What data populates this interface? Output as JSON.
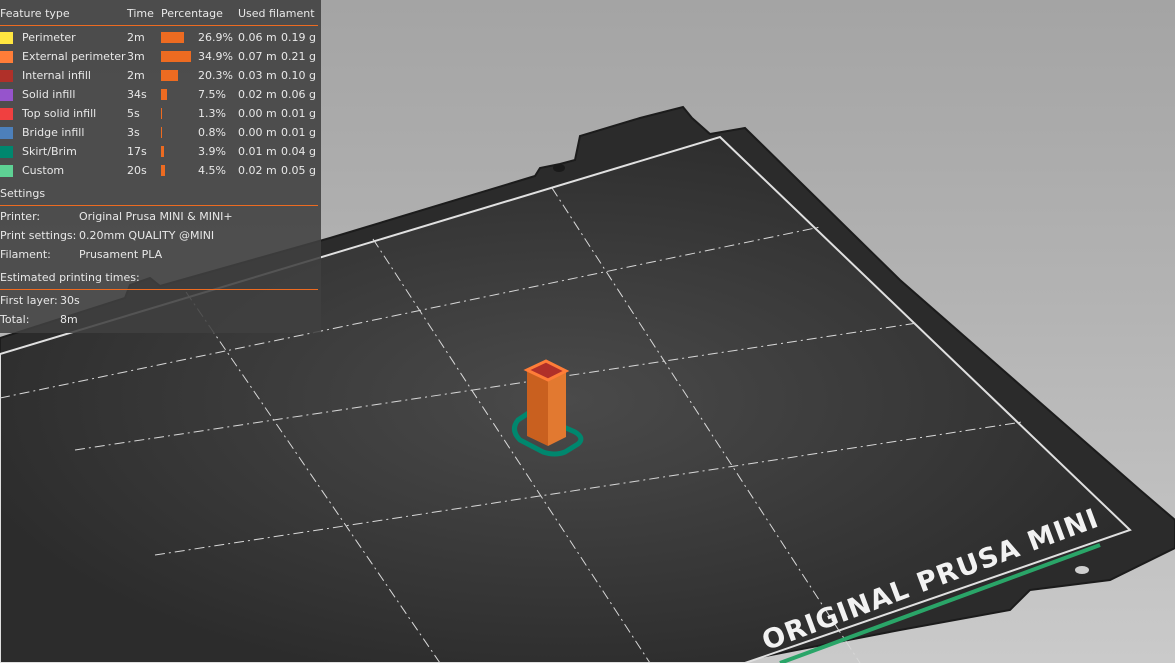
{
  "legend": {
    "headers": {
      "feature_type": "Feature type",
      "time": "Time",
      "percentage": "Percentage",
      "used_filament": "Used filament"
    },
    "features": [
      {
        "name": "Perimeter",
        "color": "#ffe640",
        "time": "2m",
        "pct": "26.9%",
        "pct_value": 26.9,
        "length": "0.06 m",
        "weight": "0.19 g"
      },
      {
        "name": "External perimeter",
        "color": "#ff7d38",
        "time": "3m",
        "pct": "34.9%",
        "pct_value": 34.9,
        "length": "0.07 m",
        "weight": "0.21 g"
      },
      {
        "name": "Internal infill",
        "color": "#b03029",
        "time": "2m",
        "pct": "20.3%",
        "pct_value": 20.3,
        "length": "0.03 m",
        "weight": "0.10 g"
      },
      {
        "name": "Solid infill",
        "color": "#9654cc",
        "time": "34s",
        "pct": "7.5%",
        "pct_value": 7.5,
        "length": "0.02 m",
        "weight": "0.06 g"
      },
      {
        "name": "Top solid infill",
        "color": "#f04040",
        "time": "5s",
        "pct": "1.3%",
        "pct_value": 1.3,
        "length": "0.00 m",
        "weight": "0.01 g"
      },
      {
        "name": "Bridge infill",
        "color": "#4d80ba",
        "time": "3s",
        "pct": "0.8%",
        "pct_value": 0.8,
        "length": "0.00 m",
        "weight": "0.01 g"
      },
      {
        "name": "Skirt/Brim",
        "color": "#00876e",
        "time": "17s",
        "pct": "3.9%",
        "pct_value": 3.9,
        "length": "0.01 m",
        "weight": "0.04 g"
      },
      {
        "name": "Custom",
        "color": "#5ed194",
        "time": "20s",
        "pct": "4.5%",
        "pct_value": 4.5,
        "length": "0.02 m",
        "weight": "0.05 g"
      }
    ],
    "settings": {
      "title": "Settings",
      "printer_label": "Printer:",
      "printer_value": "Original Prusa MINI & MINI+",
      "print_label": "Print settings:",
      "print_value": "0.20mm QUALITY @MINI",
      "filament_label": "Filament:",
      "filament_value": "Prusament PLA"
    },
    "estimated": {
      "title": "Estimated printing times:",
      "first_layer_label": "First layer:",
      "first_layer_value": "30s",
      "total_label": "Total:",
      "total_value": "8m"
    }
  },
  "bed": {
    "logo_text": "ORIGINAL PRUSA MINI"
  },
  "colors": {
    "accent": "#ed6b21",
    "bed_surface": "#333333",
    "bed_stripe": "#2aa568"
  }
}
